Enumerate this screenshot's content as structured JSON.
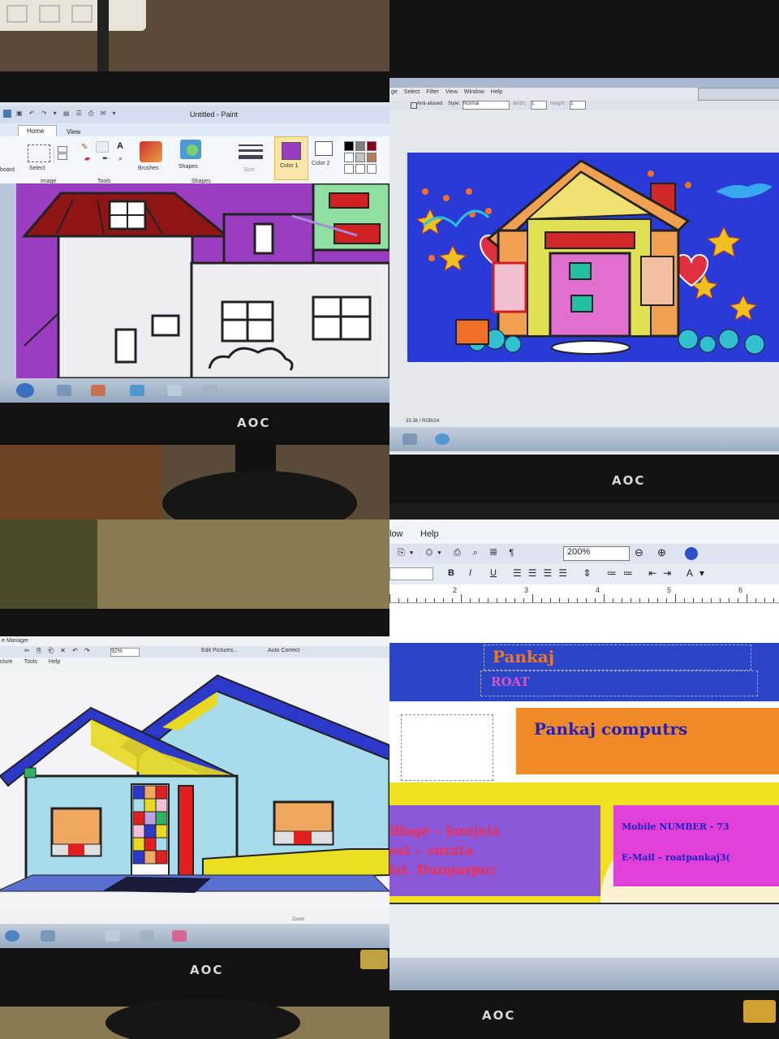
{
  "q1": {
    "window_title": "Untitled - Paint",
    "tabs": [
      "Home",
      "View"
    ],
    "groups": {
      "clipboard": "board",
      "image": "Image",
      "tools": "Tools",
      "shapes": "Shapes"
    },
    "tools": {
      "select": "Select",
      "brushes": "Brushes",
      "shapes": "Shapes",
      "size": "Size",
      "color1": "Color 1",
      "color2": "Color 2"
    },
    "palette": [
      "#000000",
      "#7f7f7f",
      "#880015",
      "#ffffff",
      "#c3c3c3",
      "#b97a57",
      "#ffffff",
      "#ffffff",
      "#ffffff"
    ],
    "color1": "#9a3cc0",
    "brand": "AOC"
  },
  "q2": {
    "menu": [
      "ge",
      "Select",
      "Filter",
      "View",
      "Window",
      "Help"
    ],
    "toolbar": {
      "anti_alias": "Anti-aliased",
      "style_label": "Style:",
      "style_value": "Normal",
      "width_label": "Width:",
      "width_value": "1",
      "height_label": "Height:",
      "height_value": "1"
    },
    "status": "33.36 / RGB/24",
    "brand": "AOC"
  },
  "q3": {
    "title_fragment": "e Manager",
    "menu": [
      "cture",
      "Tools",
      "Help"
    ],
    "zoom": "92%",
    "edit_pictures": "Edit Pictures...",
    "auto_correct": "Auto Correct",
    "status_zoom": "Zoom",
    "brand": "AOC"
  },
  "q4": {
    "menu": [
      "low",
      "Help"
    ],
    "zoom": "200%",
    "format_buttons": [
      "B",
      "I",
      "U"
    ],
    "ruler_numbers": [
      "2",
      "3",
      "4",
      "5",
      "6"
    ],
    "heading_name": "Pankaj",
    "heading_surname": "ROAT",
    "banner": "Pankaj computrs",
    "address_lines": [
      "illage – kunjela",
      "ost – surata",
      "ist. Dungarpur"
    ],
    "contact_lines": [
      "Mobile NUMBER - 73",
      "E-Mail – roatpankaj3("
    ],
    "brand": "AOC"
  }
}
